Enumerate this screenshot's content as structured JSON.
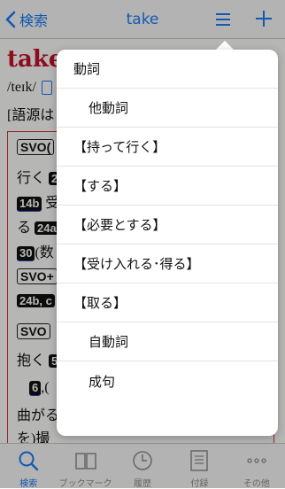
{
  "nav": {
    "back_label": "検索",
    "title": "take"
  },
  "entry": {
    "headword": "take",
    "pron": "/teɪk/",
    "etym": "[語源は",
    "lines": [
      {
        "pattern": "SVO(",
        "text": ""
      },
      {
        "pre": "行く",
        "tag": "2",
        "text": ""
      },
      {
        "tag": "14b",
        "text": "受"
      },
      {
        "pre": "る",
        "tag": "24a",
        "text": ""
      },
      {
        "tag": "30",
        "text": "(数"
      },
      {
        "pattern": "SVO+",
        "text": ""
      },
      {
        "tag": "24b, c",
        "text": ""
      },
      {
        "pattern": "SVO",
        "text": ""
      },
      {
        "pre": "抱く",
        "tag": "5",
        "text": ""
      },
      {
        "tag": "6",
        "text": ",("
      },
      {
        "pre": "曲がる",
        "text": ""
      },
      {
        "pre": "を)撮",
        "text": ""
      }
    ]
  },
  "menu": {
    "items": [
      {
        "label": "動詞",
        "level": 0
      },
      {
        "label": "他動詞",
        "level": 1
      },
      {
        "label": "【持って行く】",
        "level": 0
      },
      {
        "label": "【する】",
        "level": 0
      },
      {
        "label": "【必要とする】",
        "level": 0
      },
      {
        "label": "【受け入れる･得る】",
        "level": 0
      },
      {
        "label": "【取る】",
        "level": 0
      },
      {
        "label": "自動詞",
        "level": 1
      },
      {
        "label": "成句",
        "level": 1
      }
    ]
  },
  "tabs": [
    {
      "label": "検索",
      "icon": "search-icon",
      "active": true
    },
    {
      "label": "ブックマーク",
      "icon": "book-icon",
      "active": false
    },
    {
      "label": "履歴",
      "icon": "clock-icon",
      "active": false
    },
    {
      "label": "付録",
      "icon": "document-icon",
      "active": false
    },
    {
      "label": "その他",
      "icon": "more-icon",
      "active": false
    }
  ],
  "colors": {
    "accent": "#1a7cf5",
    "headword": "#c4132b",
    "entry_border": "#d03a3a"
  }
}
